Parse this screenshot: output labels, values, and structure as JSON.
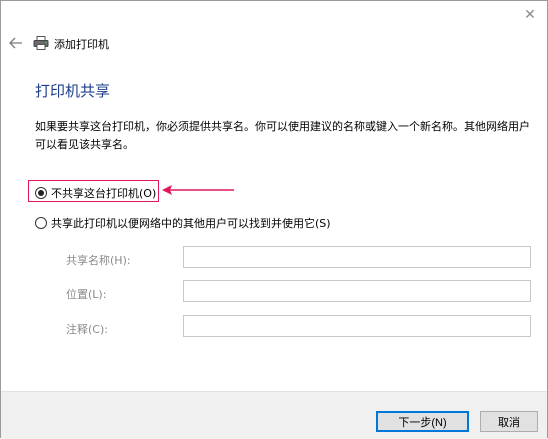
{
  "window": {
    "close_glyph": "✕"
  },
  "header": {
    "title": "添加打印机"
  },
  "heading": "打印机共享",
  "description": "如果要共享这台打印机，你必须提供共享名。你可以使用建议的名称或键入一个新名称。其他网络用户可以看见该共享名。",
  "options": {
    "no_share": {
      "label": "不共享这台打印机(O)",
      "checked": true
    },
    "share": {
      "label": "共享此打印机以便网络中的其他用户可以找到并使用它(S)",
      "checked": false
    }
  },
  "fields": {
    "share_name": {
      "label": "共享名称(H):",
      "value": ""
    },
    "location": {
      "label": "位置(L):",
      "value": ""
    },
    "comment": {
      "label": "注释(C):",
      "value": ""
    }
  },
  "footer": {
    "next_label": "下一步(N)",
    "cancel_label": "取消"
  },
  "colors": {
    "heading": "#1e3f8c",
    "annotation": "#e2175b",
    "primary_border": "#0078d7"
  }
}
